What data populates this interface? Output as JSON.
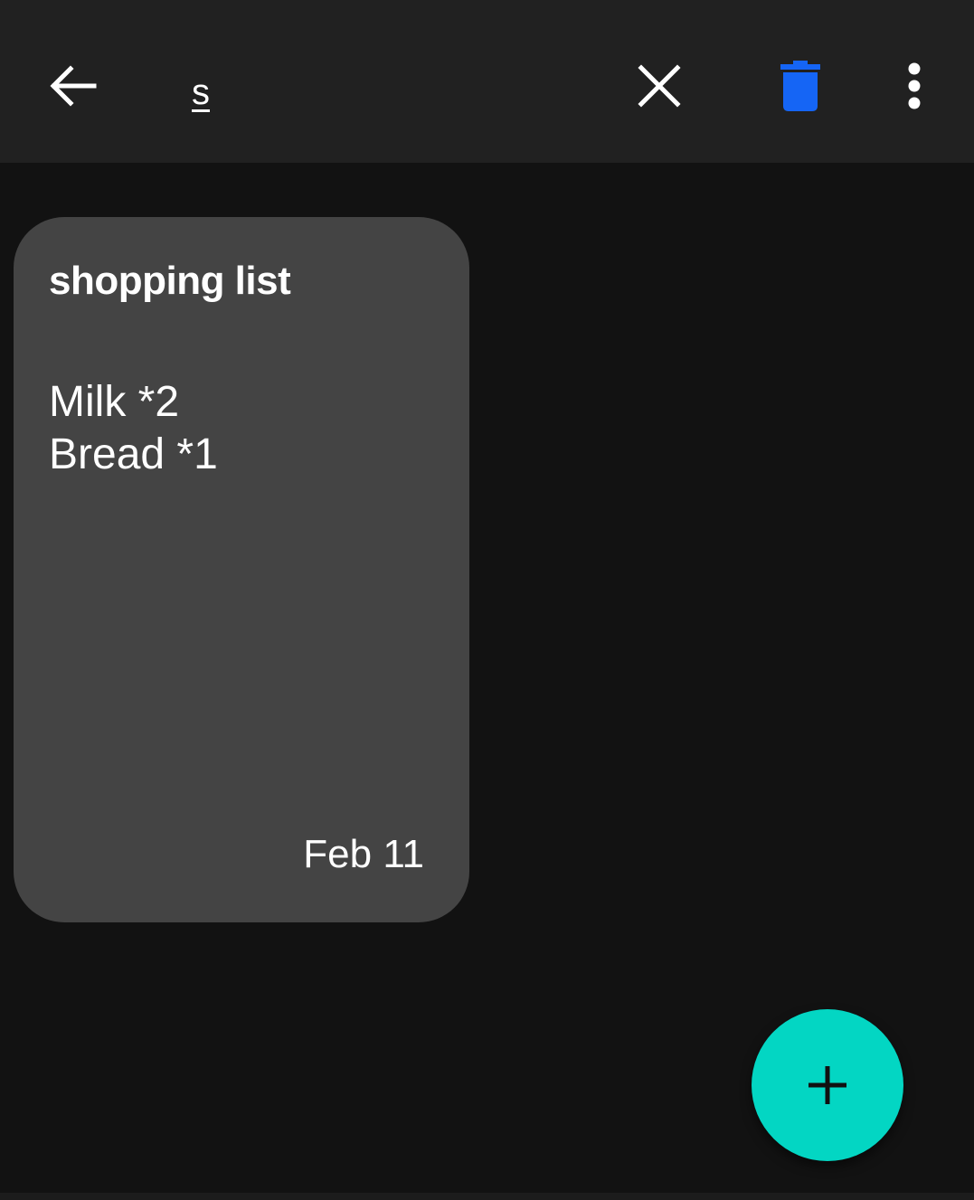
{
  "toolbar": {
    "back_icon": "arrow-left-icon",
    "search_query": "s",
    "clear_icon": "close-icon",
    "delete_icon": "trash-icon",
    "more_icon": "more-vertical-icon",
    "delete_color": "#1565f5"
  },
  "notes": [
    {
      "title": "shopping list",
      "lines": [
        "Milk *2",
        "Bread *1"
      ],
      "date": "Feb 11"
    }
  ],
  "fab": {
    "icon": "plus-icon",
    "color": "#03d6c3"
  }
}
